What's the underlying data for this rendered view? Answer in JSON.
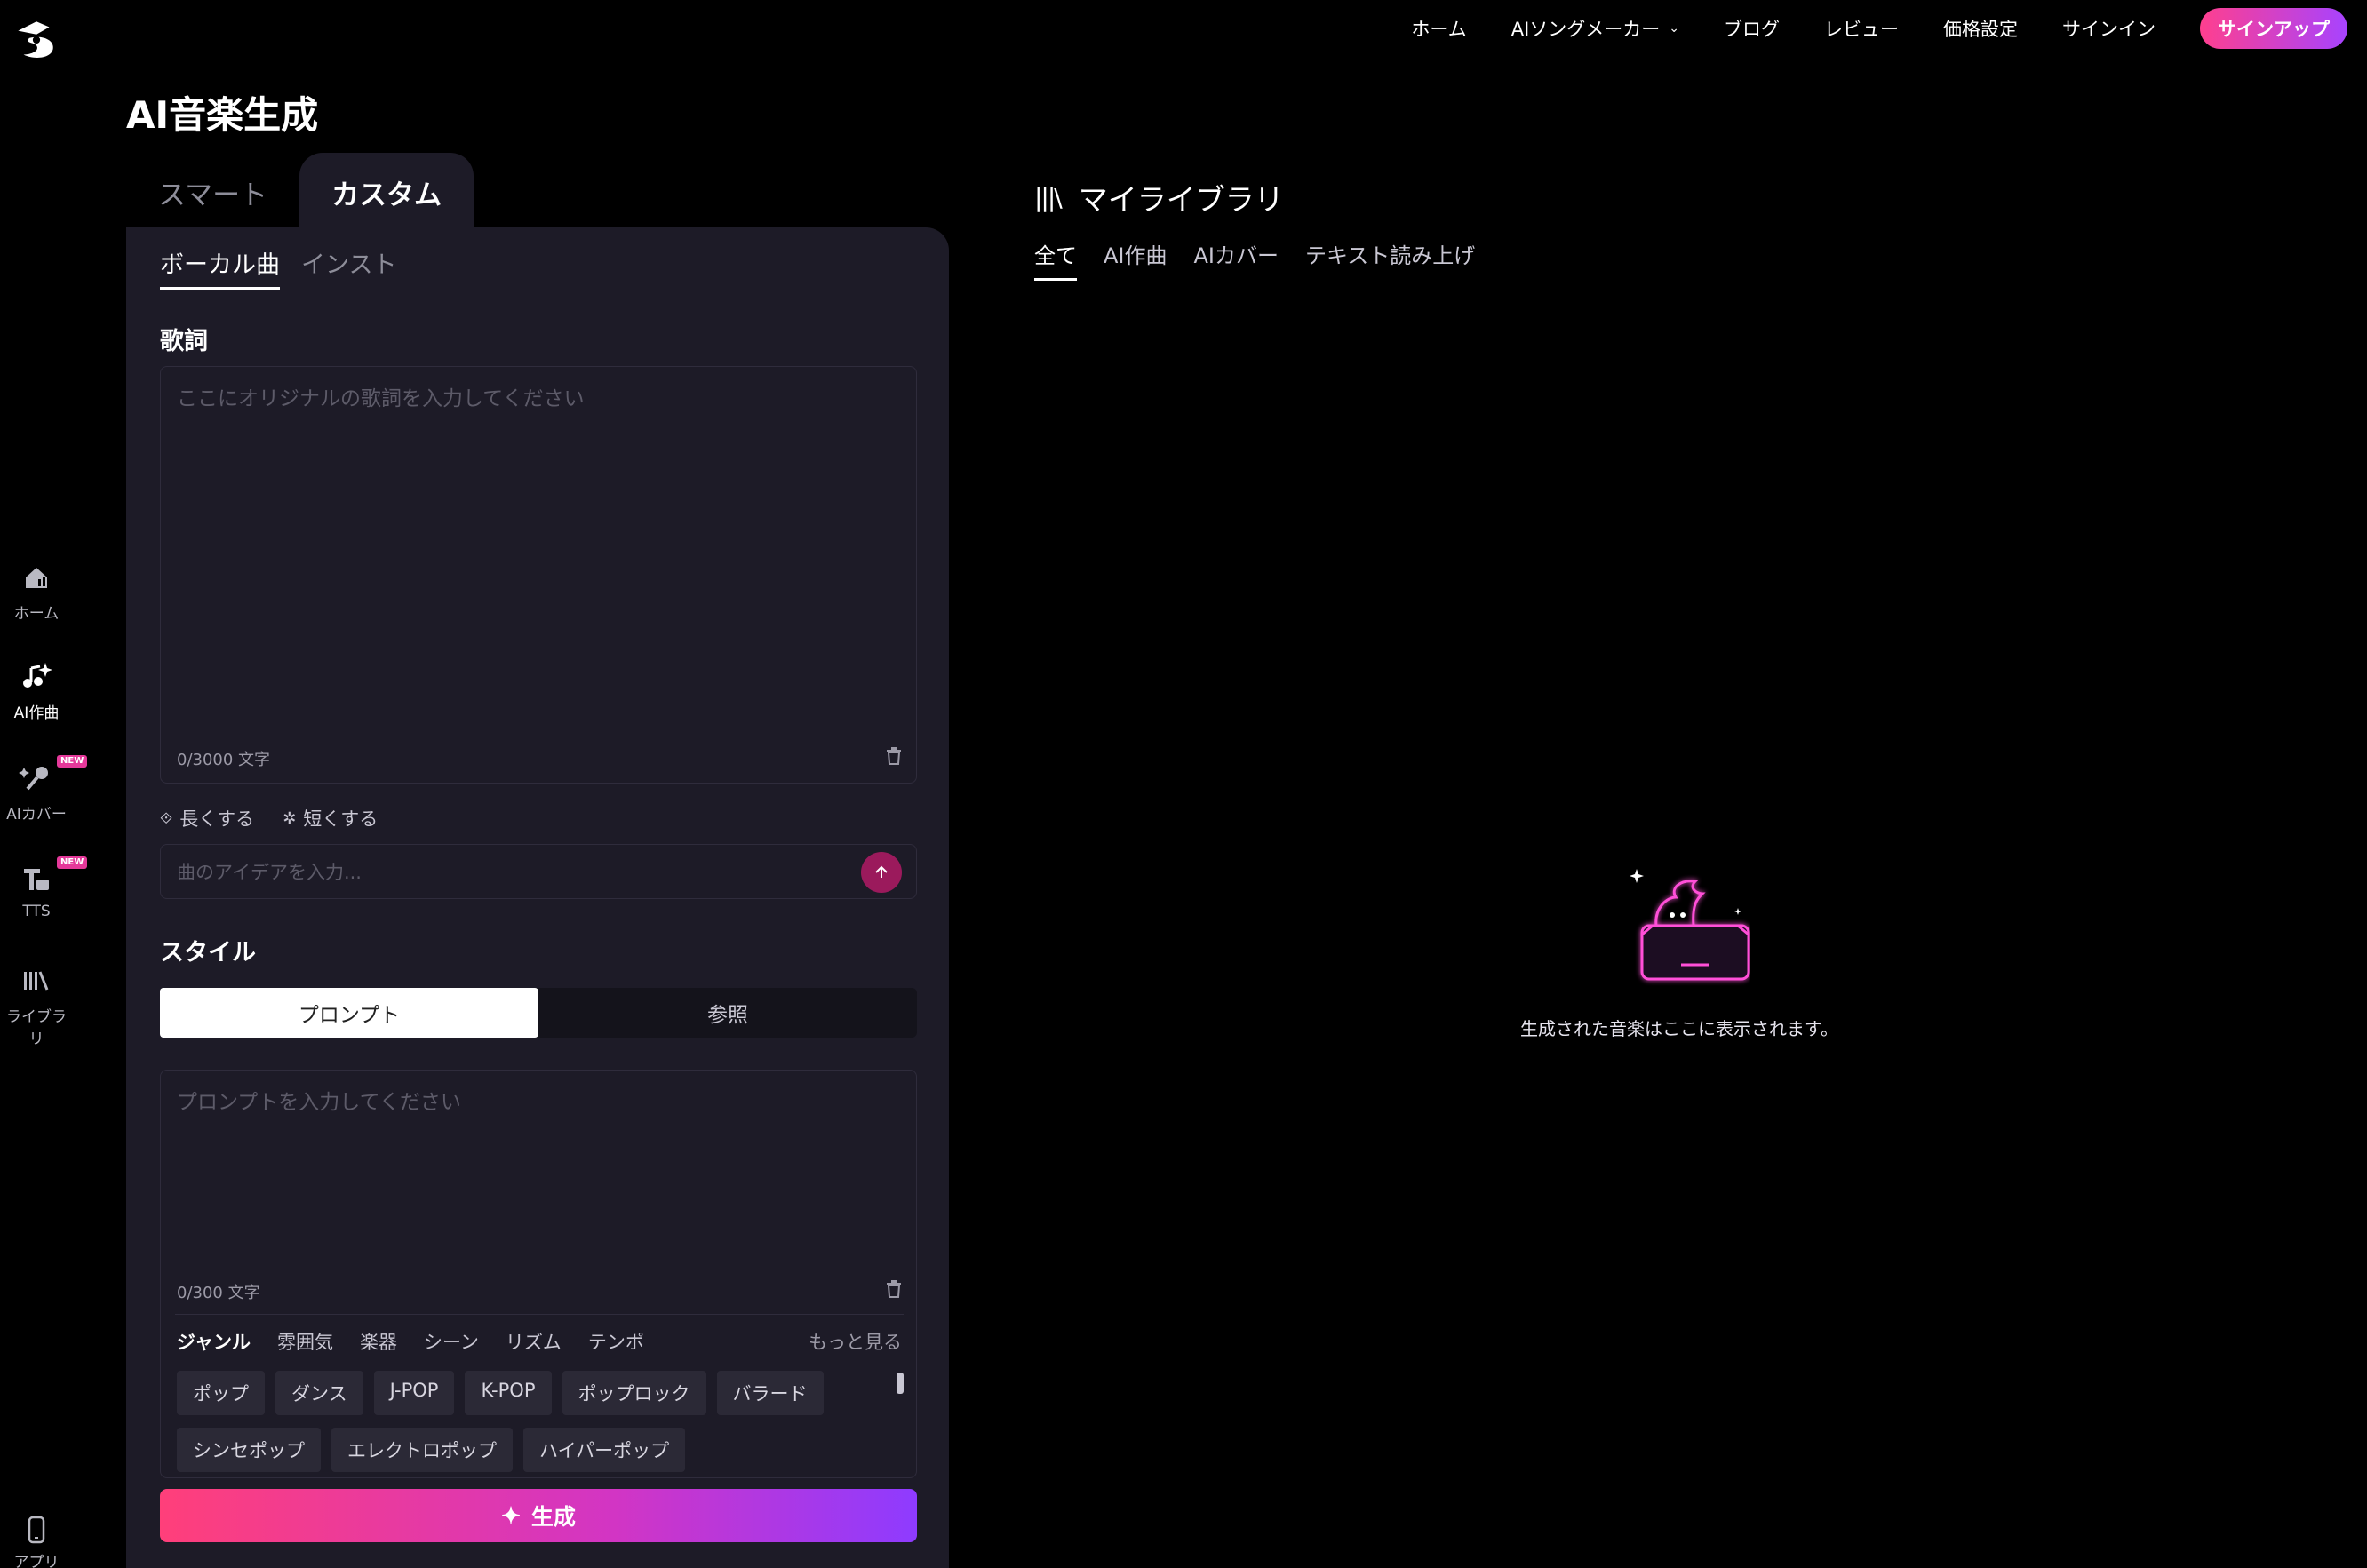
{
  "nav": {
    "items": [
      "ホーム",
      "AIソングメーカー",
      "ブログ",
      "レビュー",
      "価格設定",
      "サインイン"
    ],
    "signup": "サインアップ"
  },
  "sidebar": {
    "home": "ホーム",
    "compose": "AI作曲",
    "cover": "AIカバー",
    "tts": "TTS",
    "library": "ライブラリ",
    "app": "アプリ",
    "new_badge": "NEW"
  },
  "page_title": "AI音楽生成",
  "mode_tabs": [
    "スマート",
    "カスタム"
  ],
  "sub_tabs": [
    "ボーカル曲",
    "インスト"
  ],
  "lyrics": {
    "label": "歌詞",
    "placeholder": "ここにオリジナルの歌詞を入力してください",
    "counter": "0/3000 文字"
  },
  "actions": {
    "lengthen": "長くする",
    "shorten": "短くする"
  },
  "idea": {
    "placeholder": "曲のアイデアを入力..."
  },
  "style": {
    "label": "スタイル",
    "seg": [
      "プロンプト",
      "参照"
    ],
    "placeholder": "プロンプトを入力してください",
    "counter": "0/300 文字",
    "categories": [
      "ジャンル",
      "雰囲気",
      "楽器",
      "シーン",
      "リズム",
      "テンポ"
    ],
    "more": "もっと見る",
    "chips": [
      "ポップ",
      "ダンス",
      "J-POP",
      "K-POP",
      "ポップロック",
      "バラード",
      "シンセポップ",
      "エレクトロポップ",
      "ハイパーポップ"
    ]
  },
  "generate": "生成",
  "library": {
    "title": "マイライブラリ",
    "tabs": [
      "全て",
      "AI作曲",
      "AIカバー",
      "テキスト読み上げ"
    ],
    "empty": "生成された音楽はここに表示されます。"
  },
  "colors": {
    "accent": "#ff3f8e",
    "panel": "#1d1b27",
    "background": "#000000"
  }
}
